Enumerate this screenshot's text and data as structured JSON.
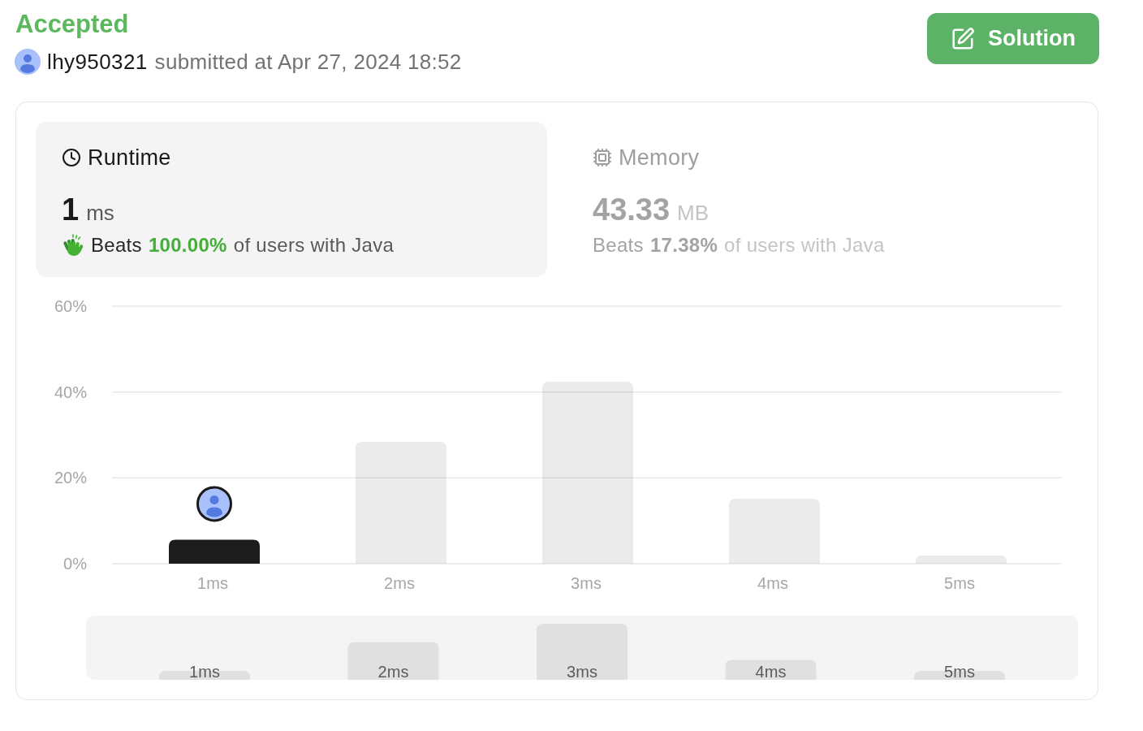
{
  "header": {
    "status": "Accepted",
    "user": "lhy950321",
    "submitted": "submitted at Apr 27, 2024 18:52"
  },
  "solution_button": {
    "label": "Solution"
  },
  "stats": [
    {
      "kind": "runtime",
      "label": "Runtime",
      "selected": true,
      "value": "1",
      "unit": "ms",
      "beats": "Beats",
      "percent": "100.00%",
      "suffix": "of users with Java"
    },
    {
      "kind": "memory",
      "label": "Memory",
      "selected": false,
      "value": "43.33",
      "unit": "MB",
      "beats": "Beats",
      "percent": "17.38%",
      "suffix": "of users with Java"
    }
  ],
  "distribution": {
    "chart_data": [
      {
        "type": "bar",
        "categories": [
          "1ms",
          "2ms",
          "3ms",
          "4ms",
          "5ms"
        ],
        "values": [
          5.6,
          28.4,
          42.4,
          15.1,
          1.9
        ],
        "ylim": [
          0,
          60
        ],
        "yticks": [
          {
            "value": 0,
            "label": "0%"
          },
          {
            "value": 20,
            "label": "20%"
          },
          {
            "value": 40,
            "label": "40%"
          },
          {
            "value": 60,
            "label": "60%"
          }
        ],
        "grid": true
      }
    ],
    "bars": [
      {
        "selected": true
      },
      {
        "selected": false
      },
      {
        "selected": false
      },
      {
        "selected": false
      },
      {
        "selected": false
      }
    ],
    "overview": {
      "labels": [
        "1ms",
        "2ms",
        "3ms",
        "4ms",
        "5ms"
      ]
    }
  }
}
